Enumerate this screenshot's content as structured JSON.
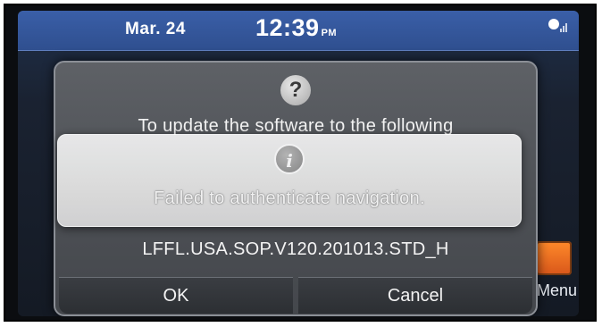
{
  "status_bar": {
    "date": "Mar. 24",
    "time": "12:39",
    "ampm": "PM",
    "signal_icon": "signal-icon"
  },
  "dialog": {
    "icon": "question-icon",
    "message": "To update the software to the following",
    "version": "LFFL.USA.SOP.V120.201013.STD_H",
    "ok_label": "OK",
    "cancel_label": "Cancel"
  },
  "toast": {
    "icon": "info-icon",
    "text": "Failed to authenticate navigation."
  },
  "background": {
    "menu_label": "Menu"
  },
  "colors": {
    "status_bar": "#2f4f8f",
    "dialog": "#4d5055",
    "toast": "#e6e6e6",
    "menu_tile": "#e86b1f"
  }
}
